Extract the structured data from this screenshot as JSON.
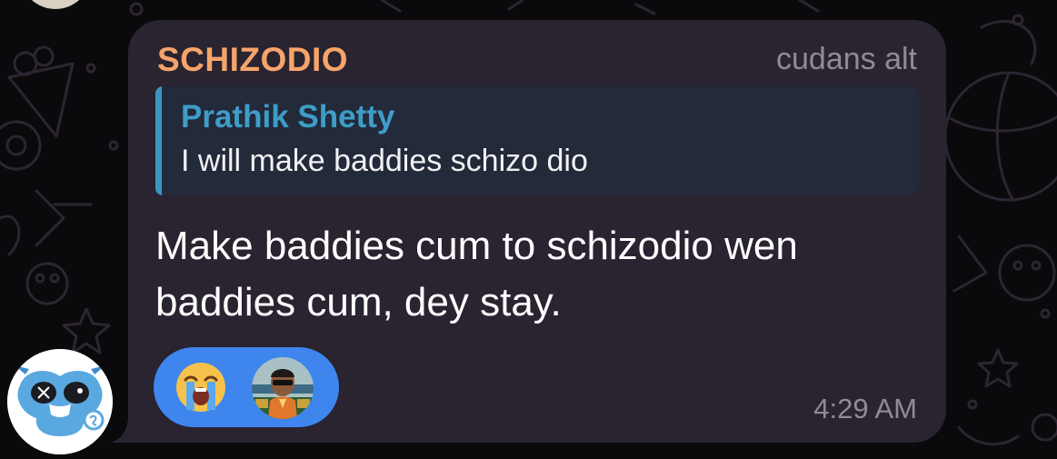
{
  "message": {
    "sender": "SCHIZODIO",
    "sender_tag": "cudans alt",
    "reply": {
      "author": "Prathik Shetty",
      "text": "I will make baddies schizo dio"
    },
    "body_line1": "Make baddies cum to schizodio wen",
    "body_line2": "baddies cum, dey stay.",
    "time": "4:29 AM",
    "reactions": [
      {
        "icon": "loudly-crying-face-emoji"
      },
      {
        "icon": "reactor-avatar"
      }
    ]
  },
  "colors": {
    "background": "#0a0a0c",
    "bubble": "#2a2330",
    "sender": "#f6a46a",
    "reply_accent": "#3e9dc8",
    "reply_background": "#232a3a",
    "reaction_pill": "#3e86ee",
    "meta_text": "#8f8c95"
  }
}
